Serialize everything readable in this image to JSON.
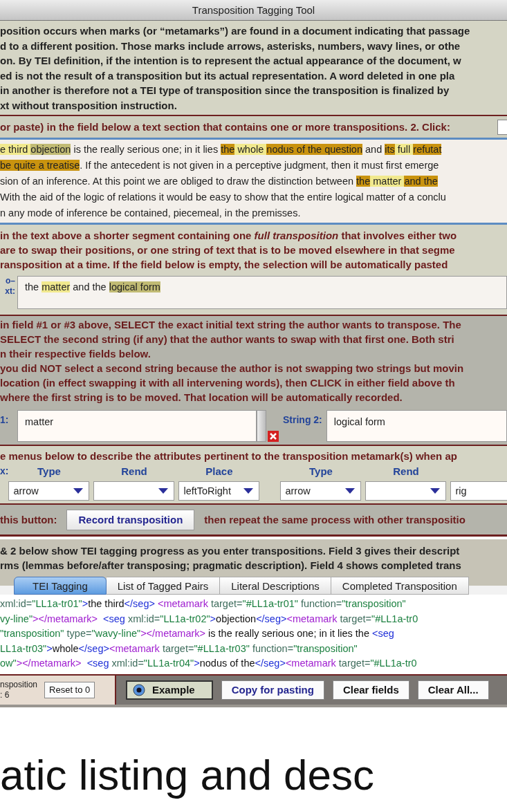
{
  "window": {
    "title": "Transposition Tagging Tool"
  },
  "intro": {
    "lines": [
      "position occurs when marks (or “metamarks”) are found in a document indicating that passage",
      "d to a different position. Those marks include arrows, asterisks, numbers, wavy lines, or othe",
      "on. By TEI definition, if the intention is to represent the actual appearance of the document, w",
      "ed is not the result of a transposition but its actual representation. A word deleted in one pla",
      "in another is therefore not a TEI type of transposition since the transposition is finalized by",
      "xt without transposition instruction."
    ]
  },
  "step1": {
    "text": "or paste) in the field below a text section that contains one or more transpositions. 2. Click:"
  },
  "source_text": {
    "lines": [
      {
        "segments": [
          {
            "text": "e third ",
            "color": "#f1e98e"
          },
          {
            "text": "objection",
            "color": "#c1bb74"
          },
          {
            "text": " is the really serious one; in it lies "
          },
          {
            "text": "the",
            "color": "#c9930f"
          },
          {
            "text": " whole ",
            "color": "#f1e98e"
          },
          {
            "text": "nodus of the",
            "color": "#c9930f"
          },
          {
            "text": " question",
            "color": "#c9930f"
          },
          {
            "text": " and "
          },
          {
            "text": "its",
            "color": "#c9930f"
          },
          {
            "text": " full ",
            "color": "#f1e98e"
          },
          {
            "text": "refutat",
            "color": "#c9930f"
          }
        ]
      },
      {
        "segments": [
          {
            "text": "be quite a ",
            "color": "#c9930f"
          },
          {
            "text": "treatise",
            "color": "#c9930f"
          },
          {
            "text": ". If the antecedent is not given in a perceptive judgment, then it must first emerge"
          }
        ]
      },
      {
        "segments": [
          {
            "text": "sion of an inference. At this point we are obliged to draw the distinction between "
          },
          {
            "text": "the",
            "color": "#c9930f"
          },
          {
            "text": " matter ",
            "color": "#f1e98e"
          },
          {
            "text": "and the",
            "color": "#c9930f"
          }
        ]
      },
      {
        "segments": [
          {
            "text": "With the aid of the logic of relations it would be easy to show that the entire logical matter of a conclu"
          }
        ]
      },
      {
        "segments": [
          {
            "text": "n any mode of inference be contained, piecemeal, in the premisses."
          }
        ]
      }
    ]
  },
  "step2": {
    "lines": [
      "in the text above a shorter segment containing one *full transposition* that involves either two",
      "are to swap their positions, or one string of text that is to be moved elsewhere in that segme",
      "ransposition at a time. If the field below is empty, the selection will be automatically pasted"
    ],
    "label_lines": [
      "o–",
      "xt:"
    ],
    "field": {
      "segments": [
        {
          "text": "the "
        },
        {
          "text": "matter",
          "color": "#f1e98e"
        },
        {
          "text": " and the "
        },
        {
          "text": "logical form",
          "color": "#c1bb74"
        }
      ]
    }
  },
  "step3": {
    "lines": [
      "in field #1 or #3 above, SELECT the exact initial text string the author wants to transpose. The",
      "SELECT the second string (if any) that the author wants to swap with that first one. Both stri",
      "n their respective fields below.",
      "you did NOT select a second string because the author is not swapping two strings but movin",
      "location (in effect swapping it with all intervening words), then CLICK in either field above th",
      "where the first string is to be moved. That location will be automatically recorded."
    ],
    "string1": {
      "label": "1:",
      "value": "matter"
    },
    "string2": {
      "label": "String 2:",
      "value": "logical form"
    }
  },
  "attributes": {
    "text": "e menus below to describe the attributes pertinent to the transposition metamark(s) when ap",
    "label": "x:",
    "groups": [
      {
        "fields": [
          {
            "header": "Type",
            "value": "arrow"
          },
          {
            "header": "Rend"
          },
          {
            "header": "Place",
            "value": "leftToRight"
          }
        ]
      },
      {
        "fields": [
          {
            "header": "Type",
            "value": "arrow"
          },
          {
            "header": "Rend"
          },
          {
            "value": "rig"
          }
        ]
      }
    ]
  },
  "record": {
    "before": "this button:",
    "button": "Record transposition",
    "after": "then repeat the same process with other transpositio"
  },
  "progress": {
    "lines": [
      "& 2 below show TEI tagging progress as you enter transpositions. Field 3 gives their descript",
      "rms (lemmas before/after transposing; pragmatic description). Field 4 shows completed trans"
    ],
    "tabs": [
      {
        "label": "TEI Tagging",
        "selected": true
      },
      {
        "label": "List of Tagged Pairs",
        "selected": false
      },
      {
        "label": "Literal Descriptions",
        "selected": false
      },
      {
        "label": "Completed Transposition",
        "selected": false
      }
    ]
  },
  "code_lines": [
    [
      {
        "kind": "attr",
        "text": "xml:id="
      },
      {
        "kind": "val",
        "text": "\"LL1a-tr01\""
      },
      {
        "kind": "tag",
        "text": ">"
      },
      {
        "kind": "text",
        "text": "the third"
      },
      {
        "kind": "tag",
        "text": "</seg>"
      },
      {
        "kind": "meta",
        "text": " <metamark"
      },
      {
        "kind": "attr",
        "text": " target="
      },
      {
        "kind": "val",
        "text": "\"#LL1a-tr01\""
      },
      {
        "kind": "attr",
        "text": " function="
      },
      {
        "kind": "val",
        "text": "\"transposition\""
      }
    ],
    [
      {
        "kind": "val",
        "text": "vy-line\""
      },
      {
        "kind": "meta",
        "text": "></metamark>"
      },
      {
        "kind": "tag",
        "text": "  <seg"
      },
      {
        "kind": "attr",
        "text": " xml:id="
      },
      {
        "kind": "val",
        "text": "\"LL1a-tr02\""
      },
      {
        "kind": "tag",
        "text": ">"
      },
      {
        "kind": "text",
        "text": "objection"
      },
      {
        "kind": "tag",
        "text": "</seg>"
      },
      {
        "kind": "meta",
        "text": "<metamark"
      },
      {
        "kind": "attr",
        "text": " target="
      },
      {
        "kind": "val",
        "text": "\"#LL1a-tr0"
      }
    ],
    [
      {
        "kind": "val",
        "text": "\"transposition\""
      },
      {
        "kind": "attr",
        "text": " type="
      },
      {
        "kind": "val",
        "text": "\"wavy-line\""
      },
      {
        "kind": "meta",
        "text": "></metamark>"
      },
      {
        "kind": "text",
        "text": " is the really serious one; in it lies the "
      },
      {
        "kind": "tag",
        "text": "<seg"
      }
    ],
    [
      {
        "kind": "val",
        "text": "LL1a-tr03\""
      },
      {
        "kind": "tag",
        "text": ">"
      },
      {
        "kind": "text",
        "text": "whole"
      },
      {
        "kind": "tag",
        "text": "</seg>"
      },
      {
        "kind": "meta",
        "text": "<metamark"
      },
      {
        "kind": "attr",
        "text": " target="
      },
      {
        "kind": "val",
        "text": "\"#LL1a-tr03\""
      },
      {
        "kind": "attr",
        "text": " function="
      },
      {
        "kind": "val",
        "text": "\"transposition\""
      }
    ],
    [
      {
        "kind": "val",
        "text": "ow\""
      },
      {
        "kind": "meta",
        "text": "></metamark>"
      },
      {
        "kind": "tag",
        "text": "  <seg"
      },
      {
        "kind": "attr",
        "text": " xml:id="
      },
      {
        "kind": "val",
        "text": "\"LL1a-tr04\""
      },
      {
        "kind": "tag",
        "text": ">"
      },
      {
        "kind": "text",
        "text": "nodus of the"
      },
      {
        "kind": "tag",
        "text": "</seg>"
      },
      {
        "kind": "meta",
        "text": "<metamark"
      },
      {
        "kind": "attr",
        "text": " target="
      },
      {
        "kind": "val",
        "text": "\"#LL1a-tr0"
      }
    ]
  ],
  "bottom": {
    "counter_lines": [
      "nsposition",
      ": 6"
    ],
    "reset": "Reset to 0",
    "example": {
      "label": "Example",
      "selected": true
    },
    "buttons": [
      "Copy for pasting",
      "Clear fields",
      "Clear All..."
    ]
  },
  "slide_caption": "atic listing and desc"
}
